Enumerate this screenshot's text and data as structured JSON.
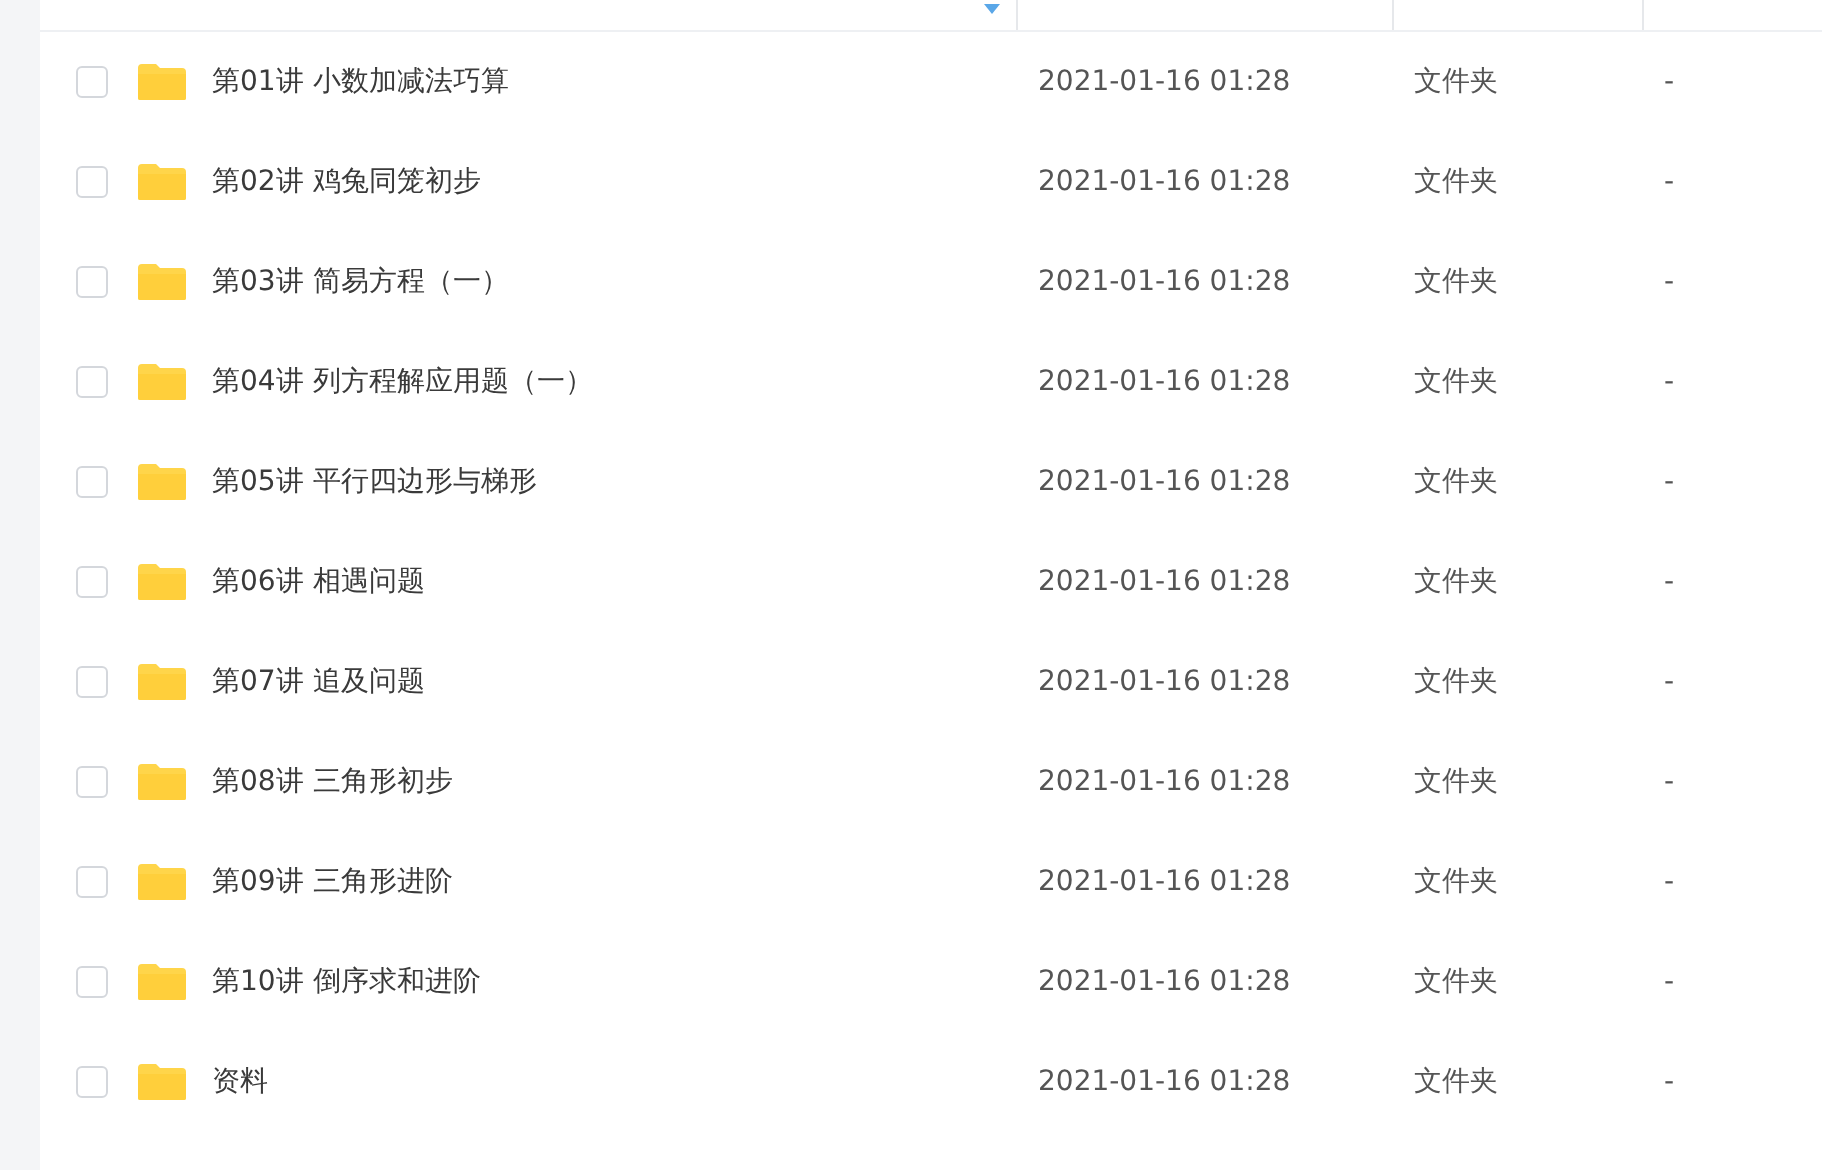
{
  "files": [
    {
      "name": "第01讲 小数加减法巧算",
      "modified": "2021-01-16 01:28",
      "type": "文件夹",
      "size": "-",
      "checked": false
    },
    {
      "name": "第02讲 鸡兔同笼初步",
      "modified": "2021-01-16 01:28",
      "type": "文件夹",
      "size": "-",
      "checked": false
    },
    {
      "name": "第03讲 简易方程（一）",
      "modified": "2021-01-16 01:28",
      "type": "文件夹",
      "size": "-",
      "checked": false
    },
    {
      "name": "第04讲 列方程解应用题（一）",
      "modified": "2021-01-16 01:28",
      "type": "文件夹",
      "size": "-",
      "checked": false
    },
    {
      "name": "第05讲 平行四边形与梯形",
      "modified": "2021-01-16 01:28",
      "type": "文件夹",
      "size": "-",
      "checked": false
    },
    {
      "name": "第06讲 相遇问题",
      "modified": "2021-01-16 01:28",
      "type": "文件夹",
      "size": "-",
      "checked": false
    },
    {
      "name": "第07讲 追及问题",
      "modified": "2021-01-16 01:28",
      "type": "文件夹",
      "size": "-",
      "checked": false
    },
    {
      "name": "第08讲 三角形初步",
      "modified": "2021-01-16 01:28",
      "type": "文件夹",
      "size": "-",
      "checked": false
    },
    {
      "name": "第09讲 三角形进阶",
      "modified": "2021-01-16 01:28",
      "type": "文件夹",
      "size": "-",
      "checked": false
    },
    {
      "name": "第10讲 倒序求和进阶",
      "modified": "2021-01-16 01:28",
      "type": "文件夹",
      "size": "-",
      "checked": false
    },
    {
      "name": "资料",
      "modified": "2021-01-16 01:28",
      "type": "文件夹",
      "size": "-",
      "checked": false
    }
  ]
}
